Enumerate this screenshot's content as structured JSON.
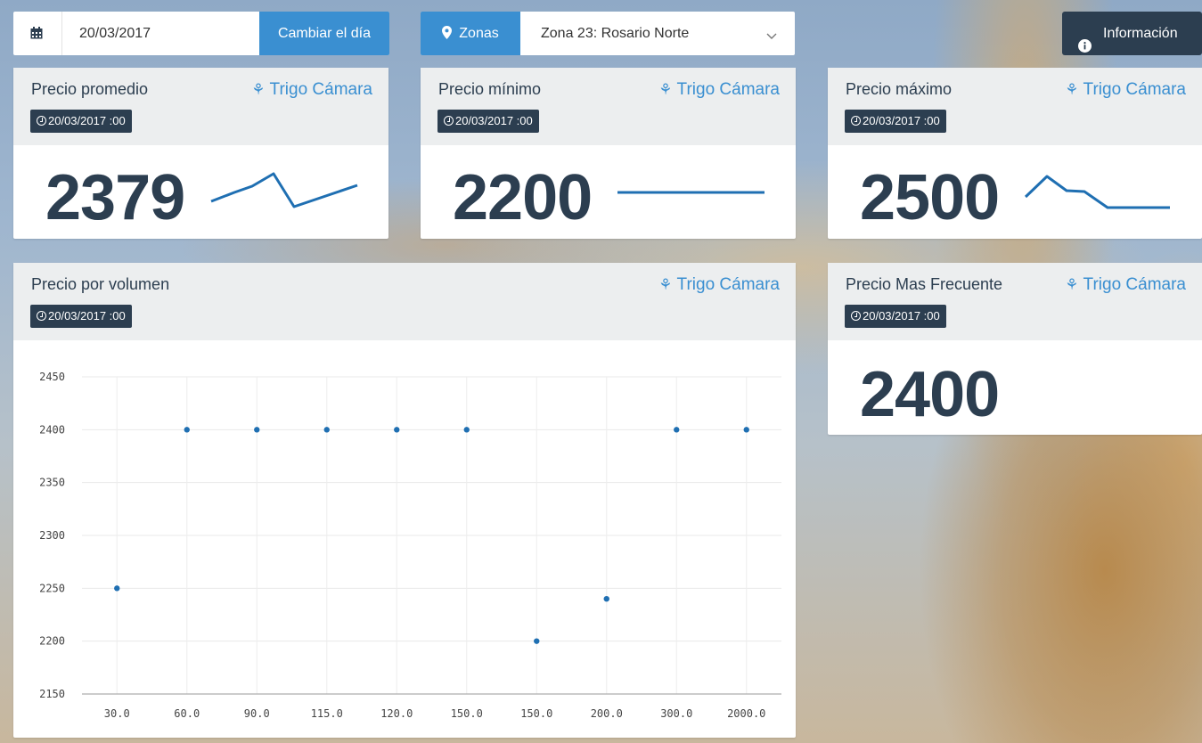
{
  "date_picker": {
    "value": "20/03/2017",
    "button": "Cambiar el día",
    "icon": "calendar-icon"
  },
  "zones": {
    "label": "Zonas",
    "selected": "Zona 23: Rosario Norte",
    "icon": "map-marker-icon"
  },
  "info_button": {
    "label": "Información",
    "icon": "info-circle-icon"
  },
  "cards": {
    "avg": {
      "title": "Precio promedio",
      "crop": "Trigo Cámara",
      "stamp": "20/03/2017 :00",
      "value": "2379"
    },
    "min": {
      "title": "Precio mínimo",
      "crop": "Trigo Cámara",
      "stamp": "20/03/2017 :00",
      "value": "2200"
    },
    "max": {
      "title": "Precio máximo",
      "crop": "Trigo Cámara",
      "stamp": "20/03/2017 :00",
      "value": "2500"
    },
    "volume": {
      "title": "Precio por volumen",
      "crop": "Trigo Cámara",
      "stamp": "20/03/2017 :00"
    },
    "freq": {
      "title": "Precio Mas Frecuente",
      "crop": "Trigo Cámara",
      "stamp": "20/03/2017 :00",
      "value": "2400"
    }
  },
  "colors": {
    "accent": "#3a8fd1",
    "dark": "#2c3e50",
    "point": "#1f6fb2"
  },
  "chart_data": {
    "type": "scatter",
    "title": "",
    "xlabel": "",
    "ylabel": "",
    "x": [
      "30.0",
      "60.0",
      "90.0",
      "115.0",
      "120.0",
      "150.0",
      "150.0",
      "200.0",
      "300.0",
      "2000.0"
    ],
    "y": [
      2250,
      2400,
      2400,
      2400,
      2400,
      2400,
      2200,
      2240,
      2400,
      2400
    ],
    "ylim": [
      2150,
      2450
    ],
    "yticks": [
      2450,
      2400,
      2350,
      2300,
      2250,
      2200,
      2150
    ],
    "grid": true
  }
}
